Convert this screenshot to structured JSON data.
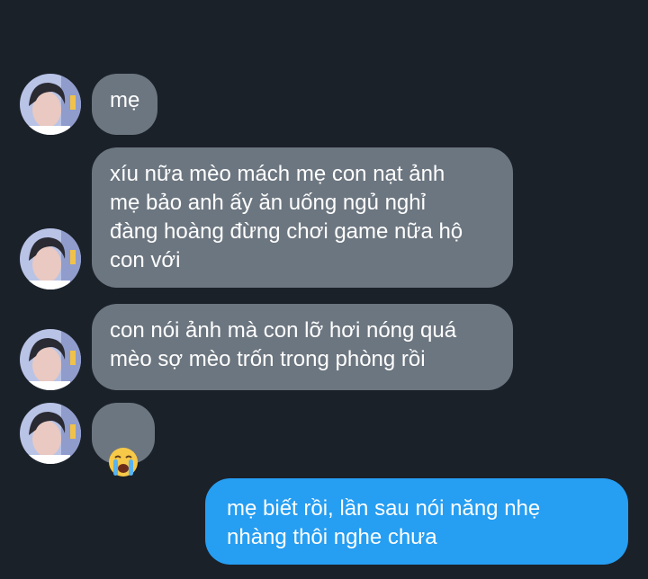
{
  "conversation": {
    "messages": [
      {
        "sender": "contact",
        "text": "mẹ"
      },
      {
        "sender": "contact",
        "text": "xíu nữa mèo mách mẹ con nạt ảnh\nmẹ bảo anh ấy ăn uống ngủ nghỉ\nđàng hoàng đừng chơi game nữa hộ\ncon với"
      },
      {
        "sender": "contact",
        "text": "con nói ảnh mà con lỡ hơi nóng quá\nmèo sợ mèo trốn trong phòng rồi"
      },
      {
        "sender": "contact",
        "emoji": "loudly-crying-face-emoji"
      },
      {
        "sender": "me",
        "text": "mẹ biết rồi, lần sau nói năng nhẹ\nnhàng thôi nghe chưa"
      }
    ]
  },
  "colors": {
    "background": "#1b2129",
    "incoming_bubble": "#6c7680",
    "outgoing_bubble": "#269ef2",
    "text": "#ffffff"
  }
}
